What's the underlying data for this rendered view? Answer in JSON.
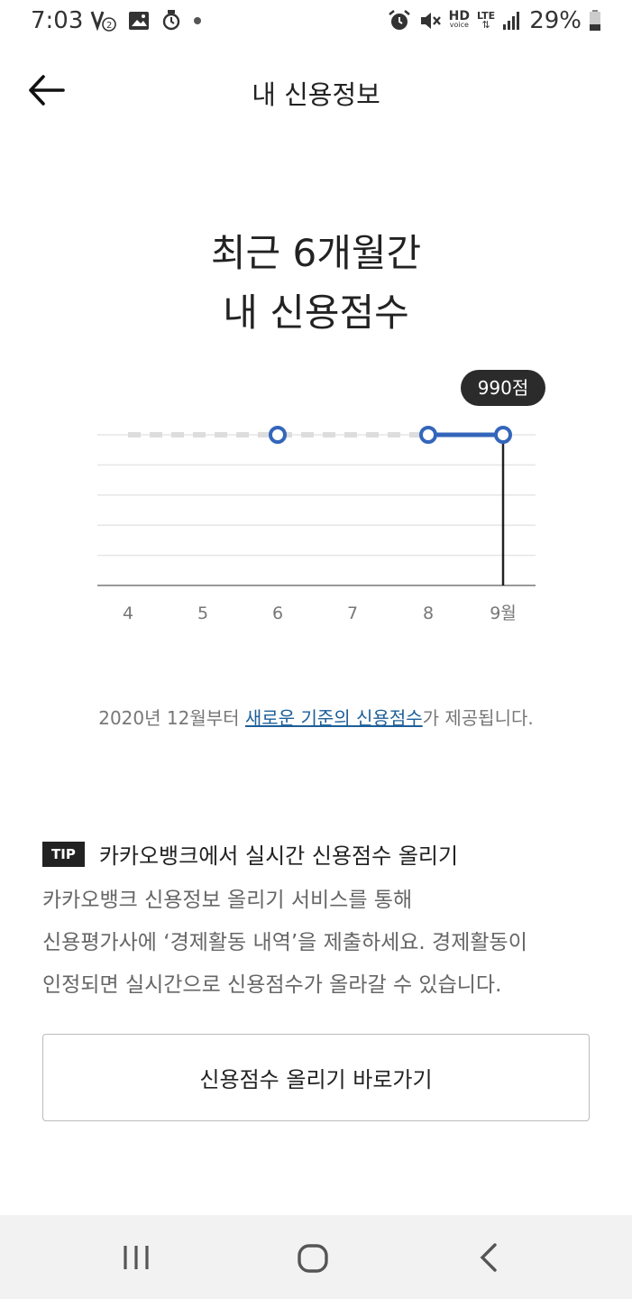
{
  "status_bar": {
    "time": "7:03",
    "battery": "29%",
    "icons": [
      "volte-2-icon",
      "gallery-icon",
      "watch-icon",
      "dot-icon",
      "alarm-icon",
      "mute-icon",
      "hd-voice-icon",
      "lte-icon",
      "signal-icon",
      "battery-icon"
    ],
    "hd_label": "HD",
    "voice_label": "voice",
    "lte_label": "LTE"
  },
  "header": {
    "title": "내 신용정보"
  },
  "main": {
    "title_line1": "최근 6개월간",
    "title_line2": "내 신용점수"
  },
  "chart_data": {
    "type": "line",
    "categories": [
      "4",
      "5",
      "6",
      "7",
      "8",
      "9월"
    ],
    "series": [
      {
        "values": [
          null,
          null,
          990,
          null,
          990,
          990
        ]
      }
    ],
    "tooltip": "990점",
    "colors": {
      "line": "#3366bb",
      "dashed": "#dddddd",
      "grid": "#e6e6e6",
      "axis": "#999999"
    }
  },
  "notice": {
    "prefix": "2020년 12월부터 ",
    "link": "새로운 기준의 신용점수",
    "suffix": "가 제공됩니다."
  },
  "tip": {
    "badge": "TIP",
    "title": "카카오뱅크에서 실시간 신용점수 올리기",
    "line1": "카카오뱅크 신용정보 올리기 서비스를 통해",
    "line2": "신용평가사에 ‘경제활동 내역’을 제출하세요. 경제활동이",
    "line3": "인정되면 실시간으로 신용점수가 올라갈 수 있습니다."
  },
  "cta": {
    "label": "신용점수 올리기 바로가기"
  },
  "nav": {
    "icons": [
      "recent-apps-icon",
      "home-icon",
      "back-nav-icon"
    ]
  }
}
